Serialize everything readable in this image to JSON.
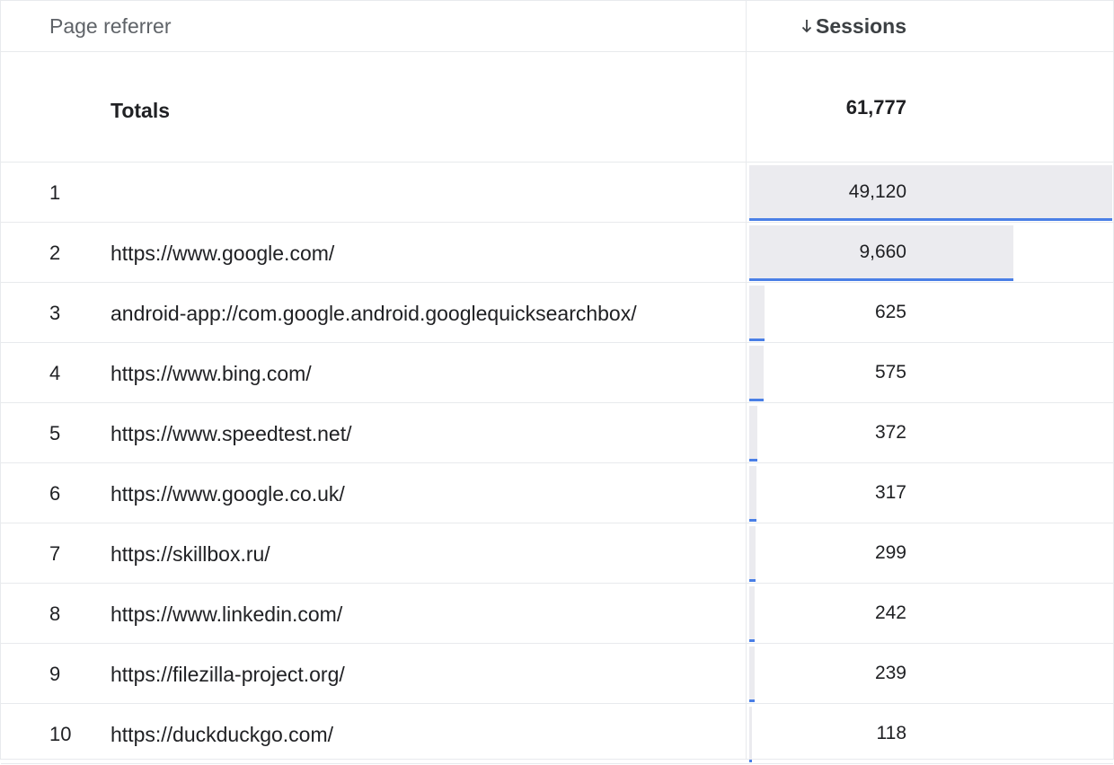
{
  "header": {
    "dimension_label": "Page referrer",
    "metric_label": "Sessions",
    "sort_icon": "arrow-down-icon"
  },
  "totals": {
    "label": "Totals",
    "value": "61,777"
  },
  "rows": [
    {
      "index": "1",
      "referrer": "",
      "sessions": "49,120",
      "share": 1.0
    },
    {
      "index": "2",
      "referrer": "https://www.google.com/",
      "sessions": "9,660",
      "share": 0.7284
    },
    {
      "index": "3",
      "referrer": "android-app://com.google.android.googlequicksearchbox/",
      "sessions": "625",
      "share": 0.0416
    },
    {
      "index": "4",
      "referrer": "https://www.bing.com/",
      "sessions": "575",
      "share": 0.0392
    },
    {
      "index": "5",
      "referrer": "https://www.speedtest.net/",
      "sessions": "372",
      "share": 0.022
    },
    {
      "index": "6",
      "referrer": "https://www.google.co.uk/",
      "sessions": "317",
      "share": 0.0196
    },
    {
      "index": "7",
      "referrer": "https://skillbox.ru/",
      "sessions": "299",
      "share": 0.0172
    },
    {
      "index": "8",
      "referrer": "https://www.linkedin.com/",
      "sessions": "242",
      "share": 0.0147
    },
    {
      "index": "9",
      "referrer": "https://filezilla-project.org/",
      "sessions": "239",
      "share": 0.0147
    },
    {
      "index": "10",
      "referrer": "https://duckduckgo.com/",
      "sessions": "118",
      "share": 0.0074
    }
  ],
  "colors": {
    "bar_fill": "#ebebef",
    "bar_line": "#4a7fe6",
    "grid": "#e8eaed"
  }
}
